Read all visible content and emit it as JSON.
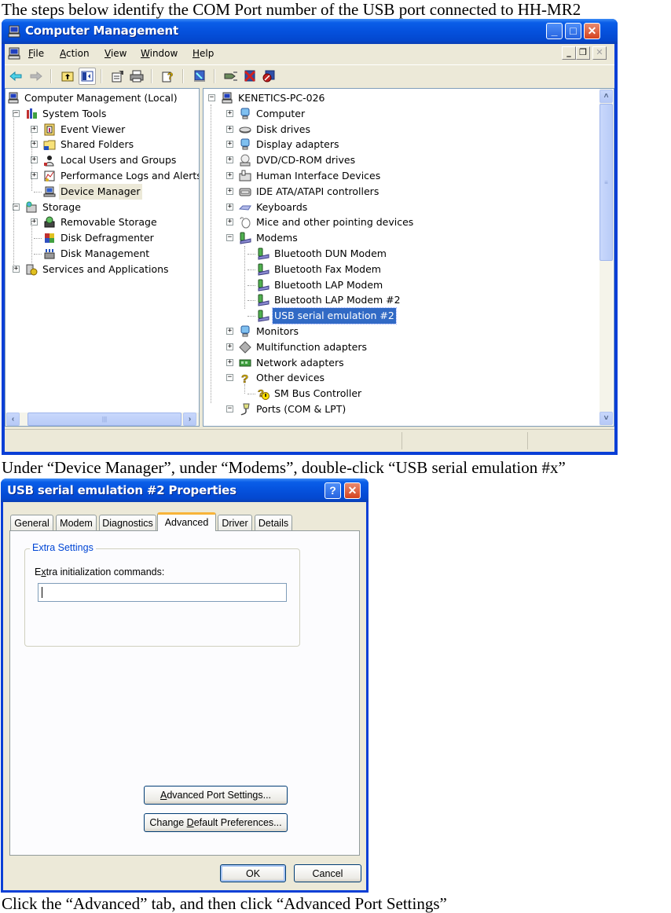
{
  "captions": {
    "step1": "The steps below identify the COM Port number of the USB port connected to HH-MR2",
    "step2": "Under “Device Manager”, under “Modems”, double-click “USB serial emulation #x”",
    "step3": "Click the “Advanced” tab, and then click “Advanced Port Settings”"
  },
  "computer_management": {
    "title": "Computer Management",
    "window_controls": {
      "minimize": "_",
      "maximize": "□",
      "close": "✕"
    },
    "menu": [
      {
        "label": "File",
        "access_key": "F",
        "rest": "ile"
      },
      {
        "label": "Action",
        "access_key": "A",
        "rest": "ction"
      },
      {
        "label": "View",
        "access_key": "V",
        "rest": "iew"
      },
      {
        "label": "Window",
        "access_key": "W",
        "rest": "indow"
      },
      {
        "label": "Help",
        "access_key": "H",
        "rest": "elp"
      }
    ],
    "mdi_controls": {
      "minimize": "_",
      "restore": "❐",
      "close": "✕"
    },
    "toolbar": [
      {
        "name": "back",
        "icon": "back-arrow-icon"
      },
      {
        "name": "forward",
        "icon": "forward-arrow-icon"
      },
      {
        "name": "up-one-level",
        "icon": "folder-up-icon"
      },
      {
        "name": "show-hide-console-tree",
        "icon": "console-tree-icon",
        "pressed": true
      },
      {
        "name": "properties",
        "icon": "properties-icon"
      },
      {
        "name": "print",
        "icon": "printer-icon"
      },
      {
        "name": "help",
        "icon": "help-icon"
      },
      {
        "name": "scan-hardware",
        "icon": "scan-hardware-icon"
      },
      {
        "name": "update-driver",
        "icon": "update-driver-icon"
      },
      {
        "name": "uninstall",
        "icon": "uninstall-icon"
      },
      {
        "name": "disable",
        "icon": "disable-icon"
      }
    ],
    "left_tree": [
      {
        "label": "Computer Management (Local)",
        "level": 0,
        "expander": null,
        "icon": "computer-icon"
      },
      {
        "label": "System Tools",
        "level": 1,
        "expander": "-",
        "icon": "tools-icon"
      },
      {
        "label": "Event Viewer",
        "level": 2,
        "expander": "+",
        "icon": "event-viewer-icon"
      },
      {
        "label": "Shared Folders",
        "level": 2,
        "expander": "+",
        "icon": "folder-icon"
      },
      {
        "label": "Local Users and Groups",
        "level": 2,
        "expander": "+",
        "icon": "users-icon"
      },
      {
        "label": "Performance Logs and Alerts",
        "level": 2,
        "expander": "+",
        "icon": "performance-icon"
      },
      {
        "label": "Device Manager",
        "level": 2,
        "expander": null,
        "icon": "device-manager-icon",
        "highlighted": true
      },
      {
        "label": "Storage",
        "level": 1,
        "expander": "-",
        "icon": "storage-icon"
      },
      {
        "label": "Removable Storage",
        "level": 2,
        "expander": "+",
        "icon": "removable-storage-icon"
      },
      {
        "label": "Disk Defragmenter",
        "level": 2,
        "expander": null,
        "icon": "defragmenter-icon"
      },
      {
        "label": "Disk Management",
        "level": 2,
        "expander": null,
        "icon": "disk-management-icon"
      },
      {
        "label": "Services and Applications",
        "level": 1,
        "expander": "+",
        "icon": "services-icon"
      }
    ],
    "right_tree": [
      {
        "label": "KENETICS-PC-026",
        "level": 0,
        "expander": "-",
        "icon": "computer-icon"
      },
      {
        "label": "Computer",
        "level": 1,
        "expander": "+",
        "icon": "monitor-icon"
      },
      {
        "label": "Disk drives",
        "level": 1,
        "expander": "+",
        "icon": "disk-drive-icon"
      },
      {
        "label": "Display adapters",
        "level": 1,
        "expander": "+",
        "icon": "display-adapter-icon"
      },
      {
        "label": "DVD/CD-ROM drives",
        "level": 1,
        "expander": "+",
        "icon": "cdrom-icon"
      },
      {
        "label": "Human Interface Devices",
        "level": 1,
        "expander": "+",
        "icon": "hid-icon"
      },
      {
        "label": "IDE ATA/ATAPI controllers",
        "level": 1,
        "expander": "+",
        "icon": "ide-controller-icon"
      },
      {
        "label": "Keyboards",
        "level": 1,
        "expander": "+",
        "icon": "keyboard-icon"
      },
      {
        "label": "Mice and other pointing devices",
        "level": 1,
        "expander": "+",
        "icon": "mouse-icon"
      },
      {
        "label": "Modems",
        "level": 1,
        "expander": "-",
        "icon": "modem-icon"
      },
      {
        "label": "Bluetooth DUN Modem",
        "level": 2,
        "expander": null,
        "icon": "modem-icon"
      },
      {
        "label": "Bluetooth Fax Modem",
        "level": 2,
        "expander": null,
        "icon": "modem-icon"
      },
      {
        "label": "Bluetooth LAP Modem",
        "level": 2,
        "expander": null,
        "icon": "modem-icon"
      },
      {
        "label": "Bluetooth LAP Modem #2",
        "level": 2,
        "expander": null,
        "icon": "modem-icon"
      },
      {
        "label": "USB serial emulation #2",
        "level": 2,
        "expander": null,
        "icon": "modem-icon",
        "selected": true
      },
      {
        "label": "Monitors",
        "level": 1,
        "expander": "+",
        "icon": "monitor-icon"
      },
      {
        "label": "Multifunction adapters",
        "level": 1,
        "expander": "+",
        "icon": "multifunction-icon"
      },
      {
        "label": "Network adapters",
        "level": 1,
        "expander": "+",
        "icon": "network-adapter-icon"
      },
      {
        "label": "Other devices",
        "level": 1,
        "expander": "-",
        "icon": "unknown-device-icon"
      },
      {
        "label": "SM Bus Controller",
        "level": 2,
        "expander": null,
        "icon": "warning-device-icon"
      },
      {
        "label": "Ports (COM & LPT)",
        "level": 1,
        "expander": "-",
        "icon": "port-icon"
      }
    ],
    "scrollbars": {
      "left_horizontal": {
        "up": "‹",
        "down": "›"
      },
      "right_vertical": {
        "up": "˄",
        "down": "˅"
      }
    }
  },
  "properties_dialog": {
    "title": "USB serial emulation #2 Properties",
    "controls": {
      "help": "?",
      "close": "✕"
    },
    "tabs": [
      {
        "label": "General",
        "active": false
      },
      {
        "label": "Modem",
        "active": false
      },
      {
        "label": "Diagnostics",
        "active": false
      },
      {
        "label": "Advanced",
        "active": true
      },
      {
        "label": "Driver",
        "active": false
      },
      {
        "label": "Details",
        "active": false
      }
    ],
    "group_title": "Extra Settings",
    "field_label": "Extra initialization commands:",
    "field_value": "",
    "buttons": {
      "advanced_port_settings": "Advanced Port Settings...",
      "change_default_preferences": "Change Default Preferences...",
      "ok": "OK",
      "cancel": "Cancel"
    }
  },
  "colors": {
    "xp_title_blue": "#0551dd",
    "selection_blue": "#316ac5",
    "window_face": "#ece9d8",
    "active_tab_accent": "#f8b43a",
    "group_title": "#0046d5"
  }
}
